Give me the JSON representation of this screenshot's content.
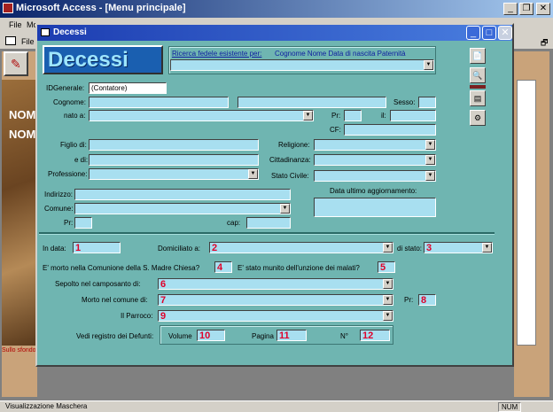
{
  "app": {
    "title": "Microsoft Access - [Menu principale]",
    "menu": [
      "File",
      "Mo"
    ],
    "toolbar_file": "File",
    "side_texts": [
      "NOM",
      "NOM"
    ],
    "side_caption": "Sullo sfondo"
  },
  "status": {
    "left": "Visualizzazione Maschera",
    "num": "NUM"
  },
  "form": {
    "title": "Decessi",
    "logo": "Decessi",
    "search_label": "Ricerca fedele esistente per:",
    "search_columns": "Cognome Nome Data di nascita Paternità",
    "labels": {
      "idgenerale": "IDGenerale:",
      "cognome": "Cognome:",
      "sesso": "Sesso:",
      "nato_a": "nato a:",
      "pr": "Pr:",
      "il": "il:",
      "cf": "CF:",
      "figlio_di": "Figlio di:",
      "e_di": "e di:",
      "professione": "Professione:",
      "religione": "Religione:",
      "cittadinanza": "Cittadinanza:",
      "stato_civile": "Stato Civile:",
      "indirizzo": "Indirizzo:",
      "comune": "Comune:",
      "pr2": "Pr:",
      "cap": "cap:",
      "data_ultimo": "Data ultimo aggiornamento:",
      "in_data": "In data:",
      "domiciliato": "Domiciliato a:",
      "di_stato": "di stato:",
      "morto_comunione": "E' morto  nella Comunione della S. Madre Chiesa?",
      "munito": "E' stato munito   dell'unzione dei malati?",
      "sepolto": "Sepolto  nel camposanto di:",
      "morto_comune": "Morto   nel comune di:",
      "pr3": "Pr:",
      "parroco": "Il Parroco:",
      "vedi_registro": "Vedi registro dei Defunti:",
      "volume": "Volume",
      "pagina": "Pagina",
      "n": "N°"
    },
    "idgenerale_value": "(Contatore)",
    "numbers": [
      "1",
      "2",
      "3",
      "4",
      "5",
      "6",
      "7",
      "8",
      "9",
      "10",
      "11",
      "12"
    ]
  }
}
